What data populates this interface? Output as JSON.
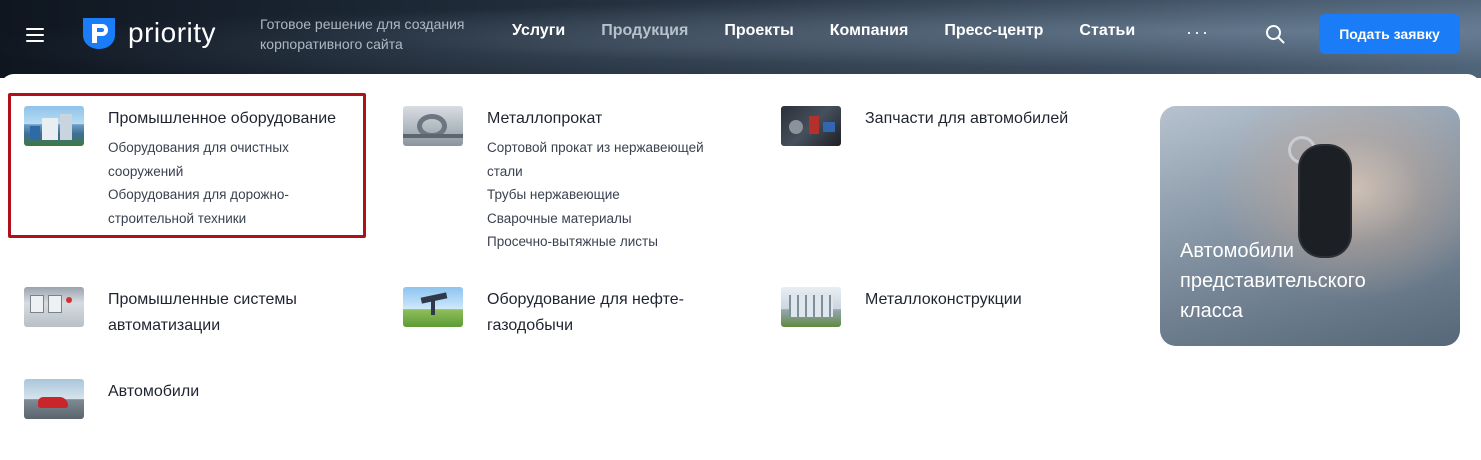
{
  "header": {
    "logo_text": "priority",
    "tagline": "Готовое решение для создания корпоративного сайта",
    "nav": [
      {
        "label": "Услуги",
        "active": false
      },
      {
        "label": "Продукция",
        "active": true
      },
      {
        "label": "Проекты",
        "active": false
      },
      {
        "label": "Компания",
        "active": false
      },
      {
        "label": "Пресс-центр",
        "active": false
      },
      {
        "label": "Статьи",
        "active": false
      }
    ],
    "more_label": "···",
    "cta_label": "Подать заявку",
    "accent_color": "#1a7cf6"
  },
  "menu": {
    "items": [
      {
        "title": "Промышленное оборудование",
        "subs": [
          "Оборудования для очистных сооружений",
          "Оборудования для дорожно-строительной техники"
        ],
        "thumb": "industrial-equipment"
      },
      {
        "title": "Металлопрокат",
        "subs": [
          "Сортовой прокат из нержавеющей стали",
          "Трубы нержавеющие",
          "Сварочные материалы",
          "Просечно-вытяжные листы"
        ],
        "thumb": "metal-rolling"
      },
      {
        "title": "Запчасти для автомобилей",
        "subs": [],
        "thumb": "car-parts"
      },
      {
        "title": "Промышленные системы автоматизации",
        "subs": [],
        "thumb": "automation"
      },
      {
        "title": "Оборудование для нефте-газодобычи",
        "subs": [],
        "thumb": "oil-gas"
      },
      {
        "title": "Металлоконструкции",
        "subs": [],
        "thumb": "metal-structures"
      },
      {
        "title": "Автомобили",
        "subs": [],
        "thumb": "cars"
      }
    ],
    "promo_title": "Автомобили представительского класса",
    "highlight_color": "#b0101a"
  }
}
